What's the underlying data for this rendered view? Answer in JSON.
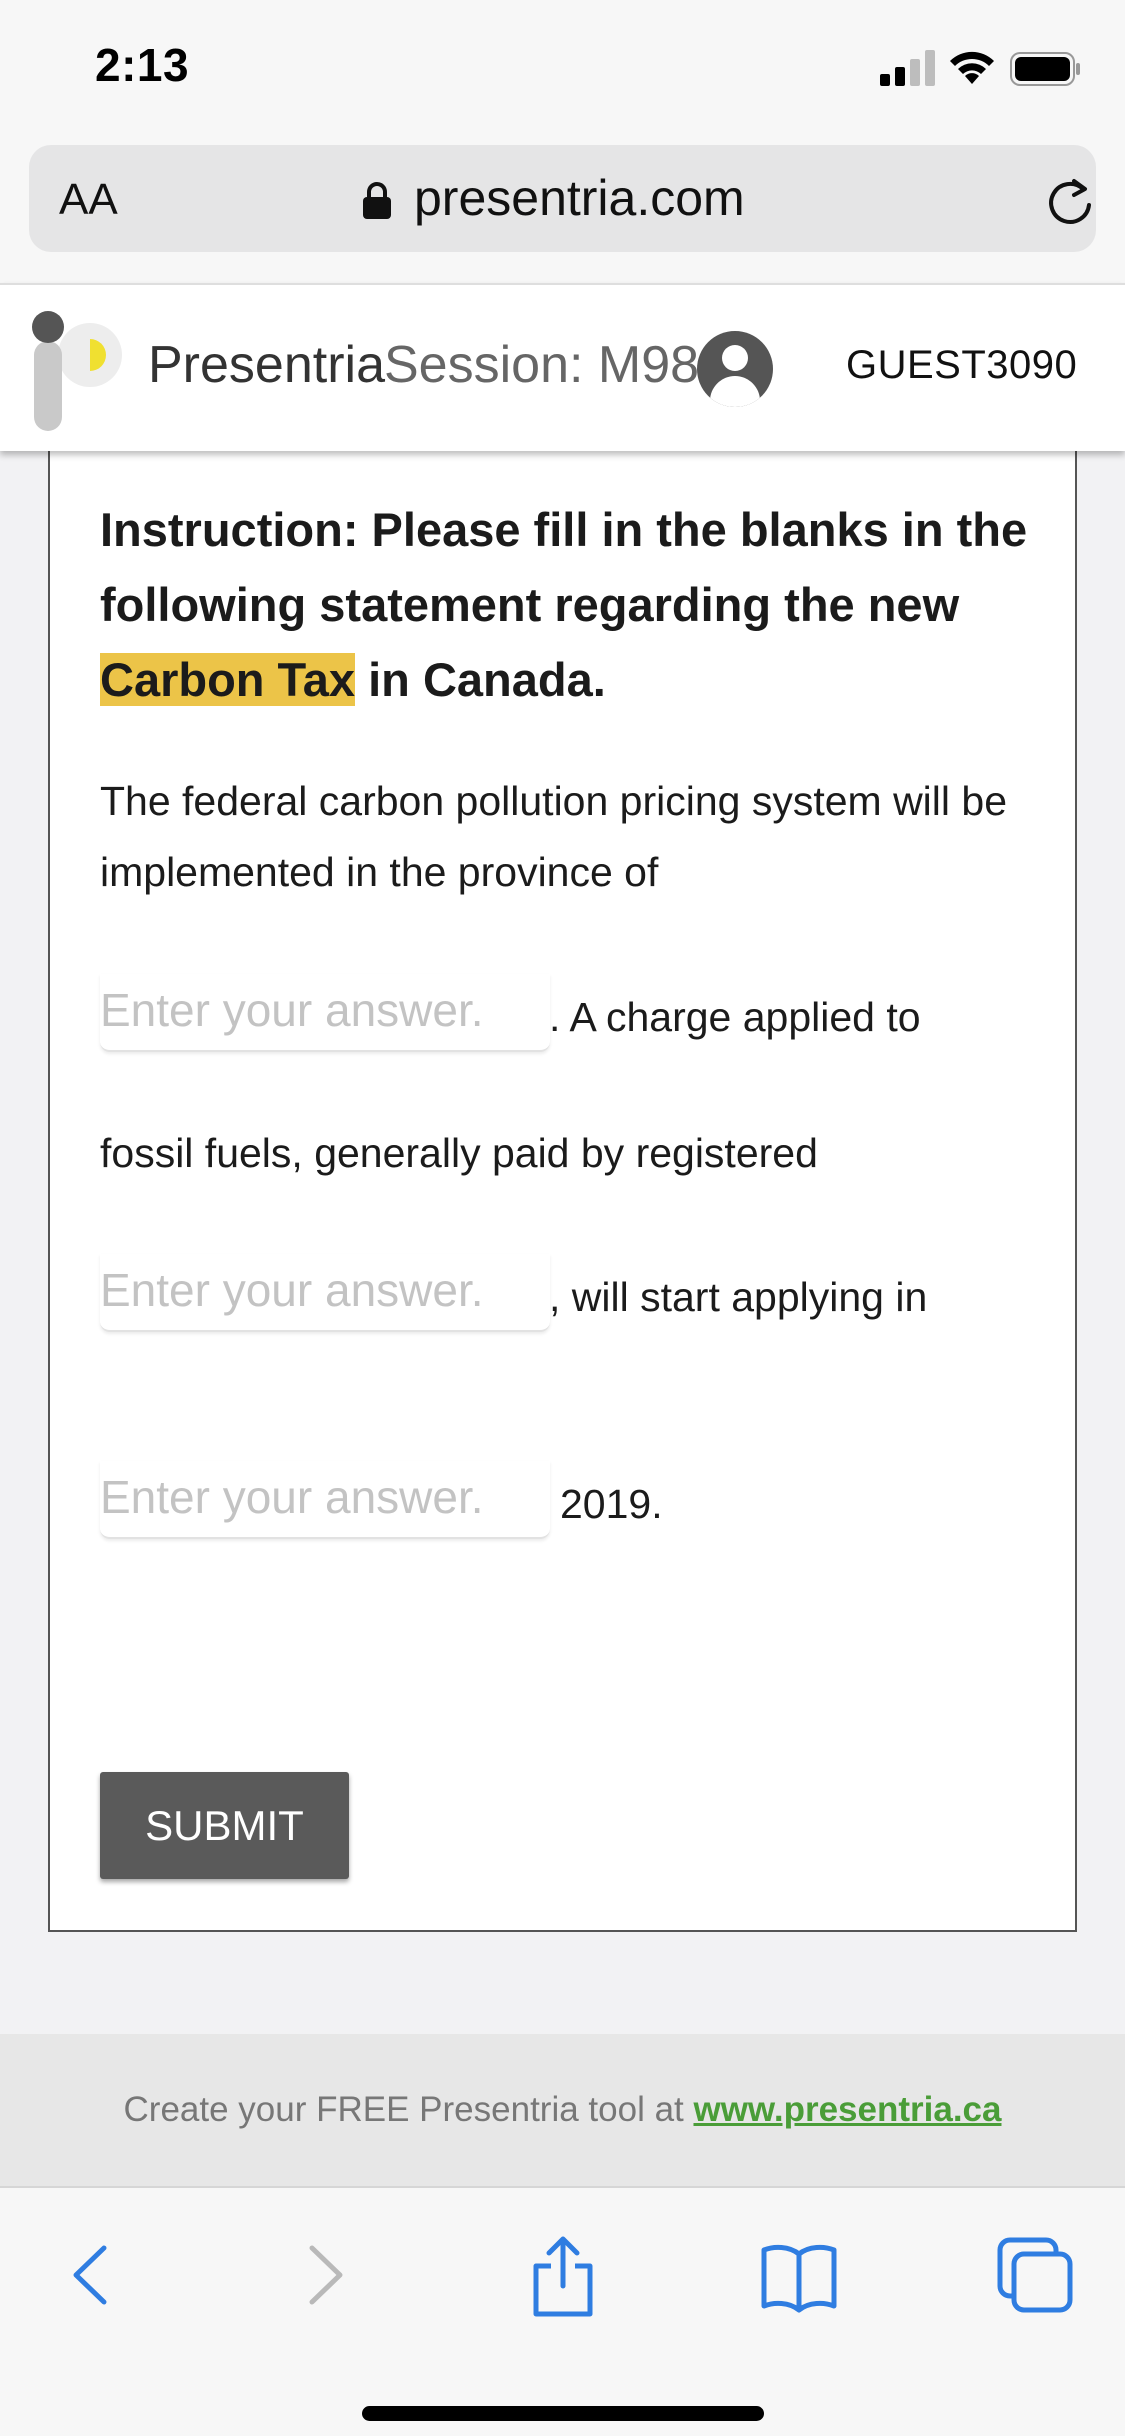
{
  "status": {
    "time": "2:13"
  },
  "browser": {
    "text_size_label": "AA",
    "domain": "presentria.com"
  },
  "header": {
    "brand": "Presentria",
    "session": "Session: M98",
    "guest": "GUEST3090"
  },
  "content": {
    "instruction_before": "Instruction: Please fill in the blanks in the following statement regarding the new ",
    "instruction_highlight": "Carbon Tax",
    "instruction_after": " in Canada.",
    "statement": "The federal carbon pollution pricing system will be implemented in the province of",
    "blank1_after": ". A charge applied to",
    "line_fossil": "fossil fuels, generally paid by registered",
    "blank2_after": ", will start applying in",
    "blank3_after": "2019.",
    "answer_placeholder": "Enter your answer.",
    "submit_label": "SUBMIT"
  },
  "footer": {
    "text": "Create your FREE Presentria tool at ",
    "link": "www.presentria.ca",
    "link_color": "#4a9d38"
  },
  "colors": {
    "highlight": "#ecc448",
    "submit_bg": "#5a5a5a",
    "accent_ios": "#1a73e8"
  }
}
